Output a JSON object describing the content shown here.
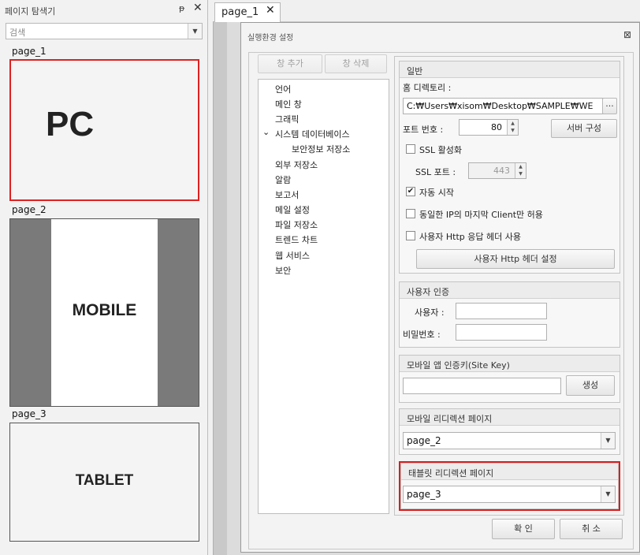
{
  "explorer": {
    "title": "페이지 탐색기",
    "pin_icon": "ᵽ",
    "close_icon": "✕",
    "search_placeholder": "검색",
    "search_arrow": "▼",
    "pages": [
      {
        "label": "page_1",
        "thumb_text": "PC"
      },
      {
        "label": "page_2",
        "thumb_text": "MOBILE"
      },
      {
        "label": "page_3",
        "thumb_text": "TABLET"
      }
    ]
  },
  "tabs": [
    {
      "label": "page_1",
      "close": "✕"
    }
  ],
  "dialog": {
    "title": "실행환경 설정",
    "close_icon": "⊠",
    "add_button": "창 추가",
    "delete_button": "창 삭제",
    "tree": [
      {
        "label": "언어"
      },
      {
        "label": "메인 창"
      },
      {
        "label": "그래픽"
      },
      {
        "label": "시스템 데이터베이스",
        "expander": "⌄"
      },
      {
        "label": "보안정보 저장소"
      },
      {
        "label": "외부 저장소"
      },
      {
        "label": "알람"
      },
      {
        "label": "보고서"
      },
      {
        "label": "메일 설정"
      },
      {
        "label": "파일 저장소"
      },
      {
        "label": "트렌드 차트"
      },
      {
        "label": "웹 서비스"
      },
      {
        "label": "보안"
      }
    ],
    "general": {
      "title": "일반",
      "home_dir_label": "홈 디렉토리 :",
      "home_dir_value": "C:₩Users₩xisom₩Desktop₩SAMPLE₩WE",
      "browse": "···",
      "port_label": "포트 번호 :",
      "port_value": "80",
      "server_config": "서버 구성",
      "ssl_enable": "SSL 활성화",
      "ssl_enable_checked": false,
      "ssl_port_label": "SSL 포트 :",
      "ssl_port_value": "443",
      "auto_start": "자동 시작",
      "auto_start_checked": true,
      "same_ip": "동일한 IP의 마지막 Client만 허용",
      "same_ip_checked": false,
      "custom_header": "사용자 Http 응답 헤더 사용",
      "custom_header_checked": false,
      "header_settings": "사용자 Http 헤더 설정",
      "spin_up": "▲",
      "spin_down": "▼",
      "check_mark": "✔"
    },
    "auth": {
      "title": "사용자 인증",
      "user_label": "사용자 :",
      "user_value": "",
      "password_label": "비밀번호 :",
      "password_value": ""
    },
    "site_key": {
      "title": "모바일 앱 인증키(Site Key)",
      "value": "",
      "generate": "생성"
    },
    "mobile_redirect": {
      "title": "모바일 리디렉션 페이지",
      "value": "page_2",
      "arrow": "▼"
    },
    "tablet_redirect": {
      "title": "태블릿 리디렉션 페이지",
      "value": "page_3",
      "arrow": "▼"
    },
    "ok": "확 인",
    "cancel": "취 소"
  }
}
